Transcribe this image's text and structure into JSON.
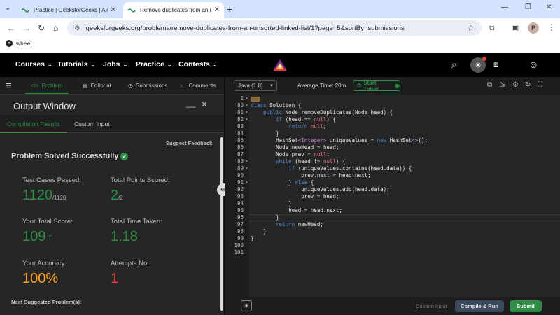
{
  "browser": {
    "tabs": [
      {
        "title": "Practice | GeeksforGeeks | A co",
        "active": false
      },
      {
        "title": "Remove duplicates from an uns",
        "active": true
      }
    ],
    "new_tab": "+",
    "url": "geeksforgeeks.org/problems/remove-duplicates-from-an-unsorted-linked-list/1?page=5&sortBy=submissions",
    "profile_initial": "P",
    "bookmark": "wheel"
  },
  "gfg_header": {
    "nav": [
      "Courses",
      "Tutorials",
      "Jobs",
      "Practice",
      "Contests"
    ]
  },
  "problem_tabs": [
    {
      "label": "Problem",
      "icon": "code-icon",
      "active": true
    },
    {
      "label": "Editorial",
      "icon": "document-icon",
      "active": false
    },
    {
      "label": "Submissions",
      "icon": "clock-icon",
      "active": false
    },
    {
      "label": "Comments",
      "icon": "comment-icon",
      "active": false
    }
  ],
  "output_window": {
    "title": "Output Window",
    "tabs": [
      "Compilation Results",
      "Custom Input"
    ],
    "suggest_feedback": "Suggest Feedback",
    "status": "Problem Solved Successfully",
    "stats": {
      "test_cases_label": "Test Cases Passed:",
      "test_cases_value": "1120",
      "test_cases_total": "/1120",
      "points_label": "Total Points Scored:",
      "points_value": "2",
      "points_total": "/2",
      "score_label": "Your Total Score:",
      "score_value": "109",
      "time_label": "Total Time Taken:",
      "time_value": "1.18",
      "accuracy_label": "Your Accuracy:",
      "accuracy_value": "100%",
      "attempts_label": "Attempts No.:",
      "attempts_value": "1"
    },
    "next_suggested": "Next Suggested Problem(s):"
  },
  "editor_toolbar": {
    "language": "Java (1.8)",
    "avg_time": "Average Time: 20m",
    "start_timer": "Start Timer"
  },
  "code": {
    "lines": [
      {
        "num": "1",
        "fold": true,
        "text": ""
      },
      {
        "num": "80",
        "fold": true,
        "text": "class Solution {"
      },
      {
        "num": "81",
        "fold": true,
        "text": "    public Node removeDuplicates(Node head) {"
      },
      {
        "num": "82",
        "fold": true,
        "text": "        if (head == null) {"
      },
      {
        "num": "83",
        "fold": false,
        "text": "            return null;"
      },
      {
        "num": "84",
        "fold": false,
        "text": "        }"
      },
      {
        "num": "85",
        "fold": false,
        "text": "        HashSet<Integer> uniqueValues = new HashSet<>();"
      },
      {
        "num": "86",
        "fold": false,
        "text": "        Node newHead = head;"
      },
      {
        "num": "87",
        "fold": false,
        "text": "        Node prev = null;"
      },
      {
        "num": "88",
        "fold": true,
        "text": "        while (head != null) {"
      },
      {
        "num": "89",
        "fold": true,
        "text": "            if (uniqueValues.contains(head.data)) {"
      },
      {
        "num": "90",
        "fold": false,
        "text": "                prev.next = head.next;"
      },
      {
        "num": "91",
        "fold": true,
        "text": "            } else {"
      },
      {
        "num": "92",
        "fold": false,
        "text": "                uniqueValues.add(head.data);"
      },
      {
        "num": "93",
        "fold": false,
        "text": "                prev = head;"
      },
      {
        "num": "94",
        "fold": false,
        "text": "            }"
      },
      {
        "num": "95",
        "fold": false,
        "text": "            head = head.next;"
      },
      {
        "num": "96",
        "fold": false,
        "text": "        }"
      },
      {
        "num": "97",
        "fold": false,
        "text": "        return newHead;"
      },
      {
        "num": "98",
        "fold": false,
        "text": "    }"
      },
      {
        "num": "99",
        "fold": false,
        "text": "}"
      },
      {
        "num": "100",
        "fold": false,
        "text": ""
      },
      {
        "num": "101",
        "fold": false,
        "text": ""
      }
    ],
    "current_line": "96"
  },
  "bottom_bar": {
    "custom_input": "Custom Input",
    "compile_run": "Compile & Run",
    "submit": "Submit"
  },
  "colors": {
    "gfg_green": "#2f8d46",
    "error_red": "#e53935",
    "accuracy_gold": "#f5a623",
    "panel_dark": "#262626"
  }
}
